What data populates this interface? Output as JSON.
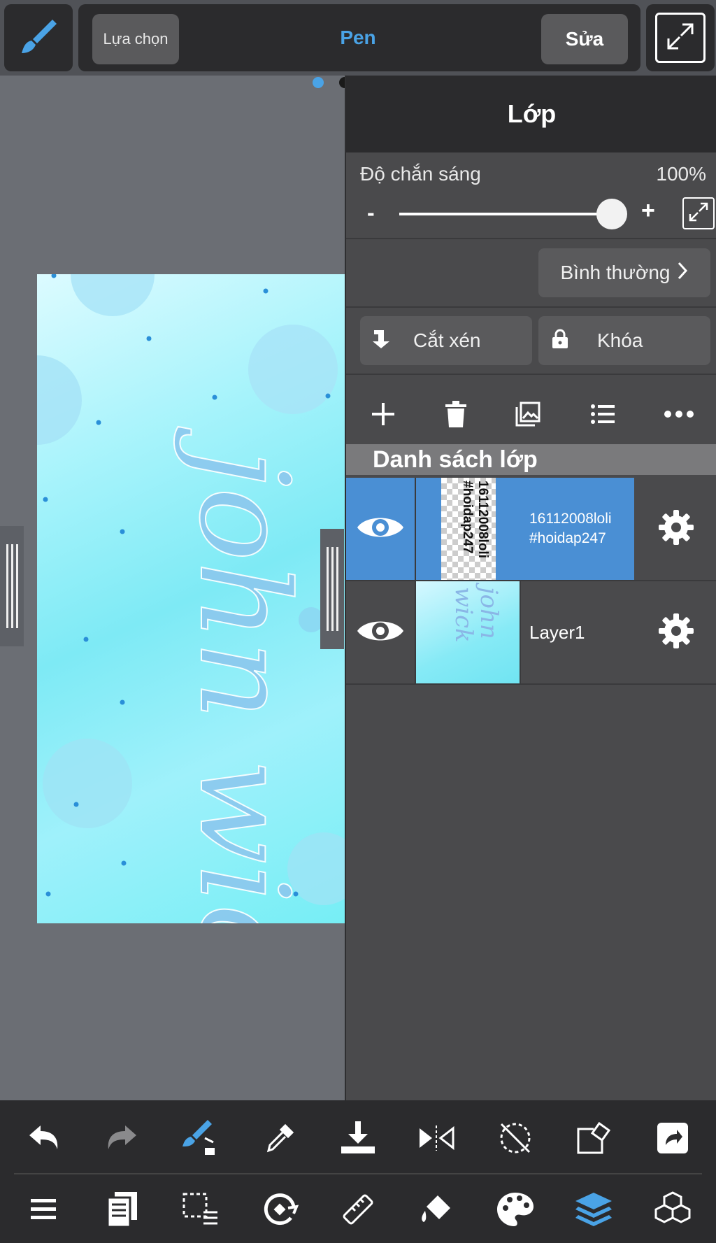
{
  "topbar": {
    "select_label": "Lựa chọn",
    "tool_name": "Pen",
    "edit_label": "Sửa"
  },
  "layer_panel": {
    "title": "Lớp",
    "opacity_label": "Độ chắn sáng",
    "opacity_value": "100%",
    "opacity_minus": "-",
    "opacity_plus": "+",
    "blend_mode": "Bình thường",
    "clip_label": "Cắt xén",
    "lock_label": "Khóa",
    "list_title": "Danh sách lớp",
    "layers": [
      {
        "name": "16112008loli #hoidap247",
        "thumb_text": "16112008loli #hoidap247",
        "selected": true
      },
      {
        "name": "Layer1",
        "thumb_text": "john wick",
        "selected": false
      }
    ]
  },
  "canvas": {
    "art_text": "john wick"
  },
  "colors": {
    "accent": "#4aa3e6",
    "panel_bg": "#4a4a4c",
    "toolbar_bg": "#2b2b2d",
    "selected_layer": "#4a8fd4",
    "canvas_cyan": "#7eeaf5"
  },
  "bottom_toolbar": {
    "row1": [
      "undo-icon",
      "redo-icon",
      "brush-transform-icon",
      "eyedropper-icon",
      "save-icon",
      "flip-icon",
      "rotate-reset-icon",
      "transform-icon",
      "share-icon"
    ],
    "row2": [
      "menu-icon",
      "pages-icon",
      "selection-icon",
      "rotate-icon",
      "ruler-icon",
      "fill-icon",
      "palette-icon",
      "layers-icon",
      "materials-icon"
    ]
  }
}
